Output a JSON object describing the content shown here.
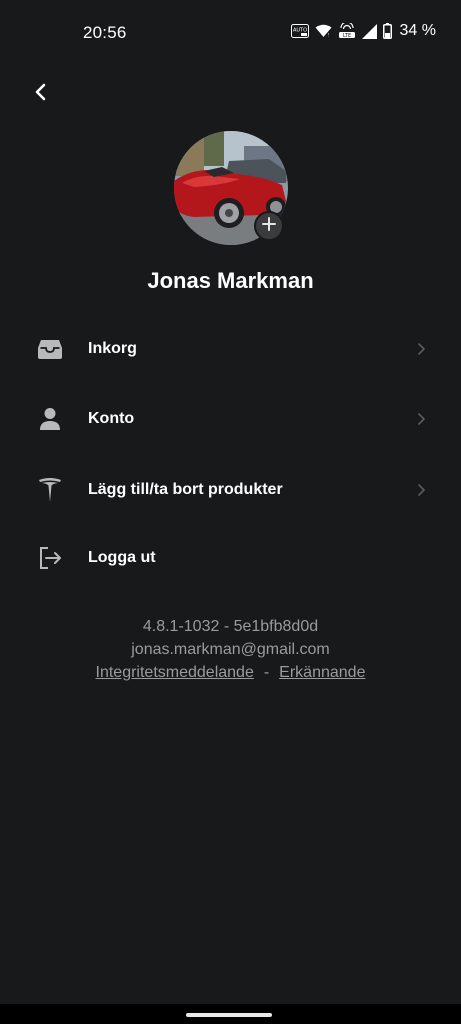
{
  "status_bar": {
    "time": "20:56",
    "auto_badge": "AUTO",
    "lte_badge": "LTE",
    "battery_percent": "34 %"
  },
  "profile": {
    "name": "Jonas Markman"
  },
  "menu": {
    "items": [
      {
        "label": "Inkorg",
        "icon": "inbox-icon",
        "has_chevron": true
      },
      {
        "label": "Konto",
        "icon": "person-icon",
        "has_chevron": true
      },
      {
        "label": "Lägg till/ta bort produkter",
        "icon": "tesla-logo-icon",
        "has_chevron": true
      },
      {
        "label": "Logga ut",
        "icon": "logout-icon",
        "has_chevron": false
      }
    ]
  },
  "footer": {
    "version": "4.8.1-1032 - 5e1bfb8d0d",
    "email": "jonas.markman@gmail.com",
    "privacy_link": "Integritetsmeddelande",
    "separator": "-",
    "acknowledgements_link": "Erkännande"
  },
  "colors": {
    "background": "#18191b",
    "text_primary": "#ffffff",
    "text_secondary": "#9a9b9d",
    "icon": "#b8b9bb"
  }
}
